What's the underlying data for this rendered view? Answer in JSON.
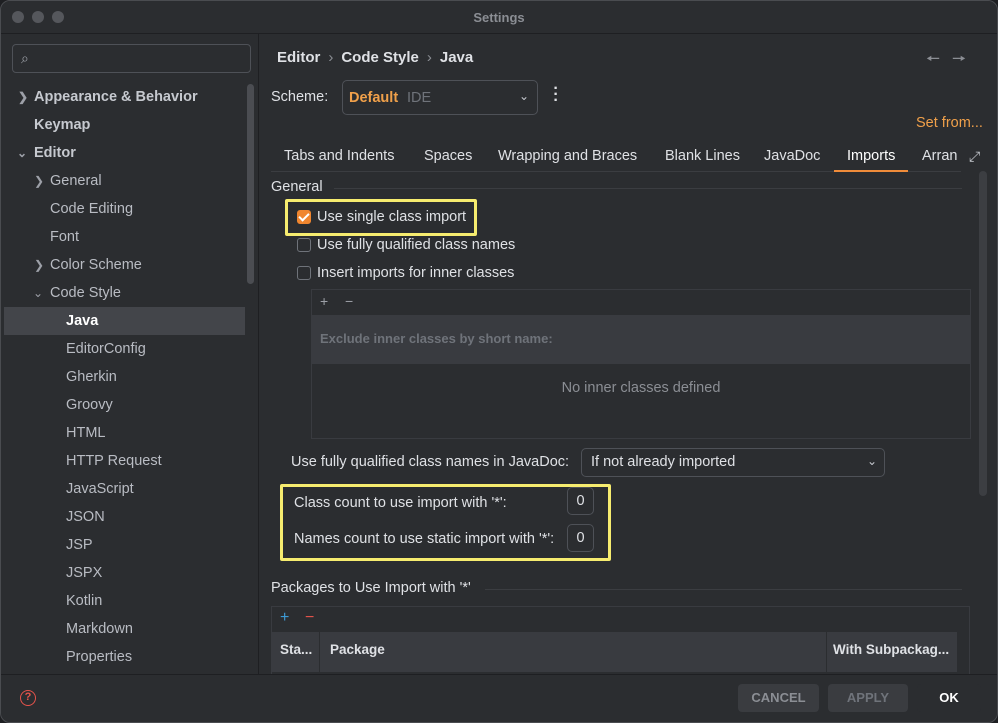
{
  "window": {
    "title": "Settings"
  },
  "sidebar": {
    "search_placeholder": "",
    "items": [
      {
        "label": "Appearance & Behavior"
      },
      {
        "label": "Keymap"
      },
      {
        "label": "Editor"
      },
      {
        "label": "General"
      },
      {
        "label": "Code Editing"
      },
      {
        "label": "Font"
      },
      {
        "label": "Color Scheme"
      },
      {
        "label": "Code Style"
      },
      {
        "label": "Java"
      },
      {
        "label": "EditorConfig"
      },
      {
        "label": "Gherkin"
      },
      {
        "label": "Groovy"
      },
      {
        "label": "HTML"
      },
      {
        "label": "HTTP Request"
      },
      {
        "label": "JavaScript"
      },
      {
        "label": "JSON"
      },
      {
        "label": "JSP"
      },
      {
        "label": "JSPX"
      },
      {
        "label": "Kotlin"
      },
      {
        "label": "Markdown"
      },
      {
        "label": "Properties"
      }
    ]
  },
  "header": {
    "breadcrumb": [
      "Editor",
      "Code Style",
      "Java"
    ],
    "back_icon": "arrow-left-icon",
    "forward_icon": "arrow-right-icon"
  },
  "scheme": {
    "label": "Scheme:",
    "value": "Default",
    "qualifier": "IDE"
  },
  "set_from": "Set from...",
  "tabs": [
    {
      "label": "Tabs and Indents"
    },
    {
      "label": "Spaces"
    },
    {
      "label": "Wrapping and Braces"
    },
    {
      "label": "Blank Lines"
    },
    {
      "label": "JavaDoc"
    },
    {
      "label": "Imports"
    },
    {
      "label": "Arran"
    }
  ],
  "general": {
    "title": "General",
    "use_single_class_import": {
      "label": "Use single class import",
      "checked": true
    },
    "use_fully_qualified": {
      "label": "Use fully qualified class names",
      "checked": false
    },
    "insert_inner": {
      "label": "Insert imports for inner classes",
      "checked": false
    },
    "inner_table": {
      "add": "+",
      "remove": "−",
      "header": "Exclude inner classes by short name:",
      "empty": "No inner classes defined"
    },
    "javadoc": {
      "label": "Use fully qualified class names in JavaDoc:",
      "value": "If not already imported"
    },
    "class_count": {
      "label": "Class count to use import with '*':",
      "value": "0"
    },
    "names_count": {
      "label": "Names count to use static import with '*':",
      "value": "0"
    }
  },
  "packages": {
    "title": "Packages to Use Import with '*'",
    "add": "+",
    "remove": "−",
    "columns": [
      "Sta...",
      "Package",
      "With Subpackag..."
    ]
  },
  "footer": {
    "help": "?",
    "cancel": "CANCEL",
    "apply": "APPLY",
    "ok": "OK"
  },
  "colors": {
    "accent": "#f0862f",
    "highlight": "#f6ec6f",
    "background": "#2b2d30"
  }
}
